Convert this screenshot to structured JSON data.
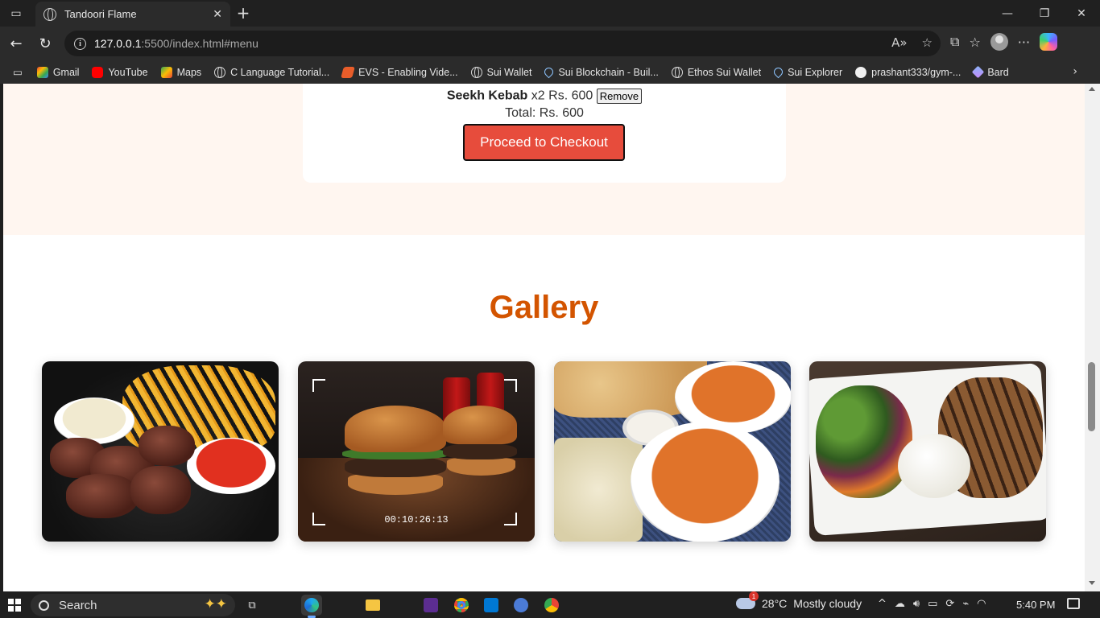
{
  "browser": {
    "tab_title": "Tandoori Flame",
    "url_host": "127.0.0.1",
    "url_path": ":5500/index.html#menu",
    "new_tab_label": "+",
    "close_tab_label": "✕"
  },
  "bookmarks": [
    {
      "label": "Gmail",
      "icon": "gmail-icon",
      "color": "#ea4335"
    },
    {
      "label": "YouTube",
      "icon": "youtube-icon",
      "color": "#ff0000"
    },
    {
      "label": "Maps",
      "icon": "maps-icon",
      "color": "#34a853"
    },
    {
      "label": "C Language Tutorial...",
      "icon": "globe-icon"
    },
    {
      "label": "EVS - Enabling Vide...",
      "icon": "evs-icon",
      "color": "#e85d2a"
    },
    {
      "label": "Sui Wallet",
      "icon": "globe-icon"
    },
    {
      "label": "Sui Blockchain - Buil...",
      "icon": "sui-drop-icon"
    },
    {
      "label": "Ethos Sui Wallet",
      "icon": "globe-icon"
    },
    {
      "label": "Sui Explorer",
      "icon": "sui-drop-icon"
    },
    {
      "label": "prashant333/gym-...",
      "icon": "github-icon"
    },
    {
      "label": "Bard",
      "icon": "bard-icon",
      "color": "#8ab4f8"
    }
  ],
  "cart": {
    "item_name": "Seekh Kebab",
    "item_qty": "x2",
    "item_price": "Rs. 600",
    "remove_label": "Remove",
    "total_text": "Total: Rs. 600",
    "checkout_label": "Proceed to Checkout"
  },
  "gallery": {
    "title": "Gallery",
    "video_timecode": "00:10:26:13"
  },
  "taskbar": {
    "search_label": "Search",
    "weather_temp": "28°C",
    "weather_desc": "Mostly cloudy",
    "weather_badge": "1",
    "time": "5:40 PM"
  },
  "colors": {
    "accent_orange": "#d35400",
    "checkout_red": "#e74c3c",
    "cart_bg": "#fff6f0"
  }
}
